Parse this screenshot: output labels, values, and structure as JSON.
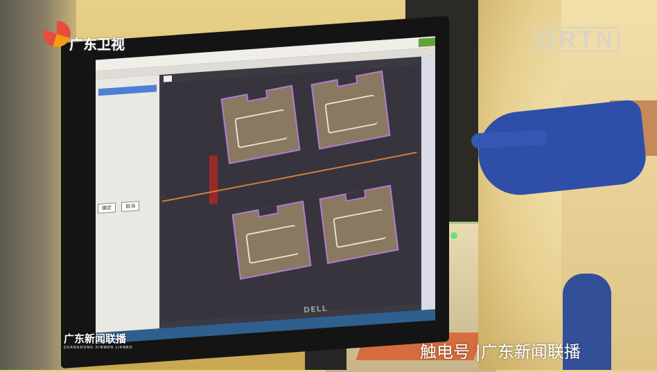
{
  "logos": {
    "channel": "广东卫视",
    "network": "GRTN",
    "program_cn": "广东新闻联播",
    "program_en": "GUANGDONG XINWEN LIANBO"
  },
  "watermark": "触电号 |广东新闻联播",
  "monitor": {
    "brand": "DELL"
  },
  "software": {
    "left_panel_buttons": [
      "确定",
      "取消"
    ]
  },
  "colors": {
    "board_outline": "#b07bd4",
    "board_fill": "#8a7961",
    "canvas": "#37343e",
    "glove": "#2e4ea8",
    "logo_red": "#e84c3d"
  }
}
